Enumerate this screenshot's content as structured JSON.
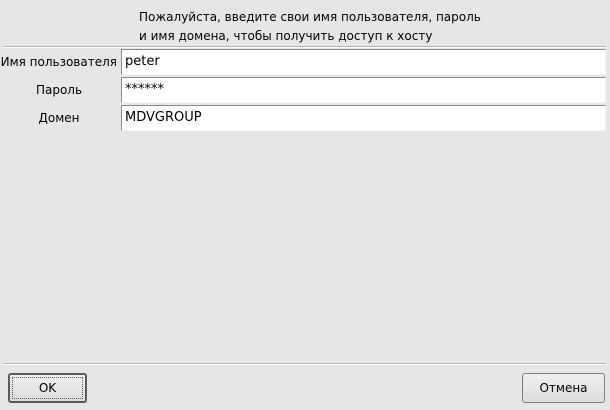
{
  "header": {
    "line1": "Пожалуйста, введите свои имя пользователя, пароль",
    "line2": "и имя домена, чтобы получить доступ к хосту"
  },
  "fields": [
    {
      "label": "Имя пользователя",
      "value": "peter"
    },
    {
      "label": "Пароль",
      "value": "******"
    },
    {
      "label": "Домен",
      "value": "MDVGROUP"
    }
  ],
  "buttons": {
    "ok": "OK",
    "cancel": "Отмена"
  }
}
